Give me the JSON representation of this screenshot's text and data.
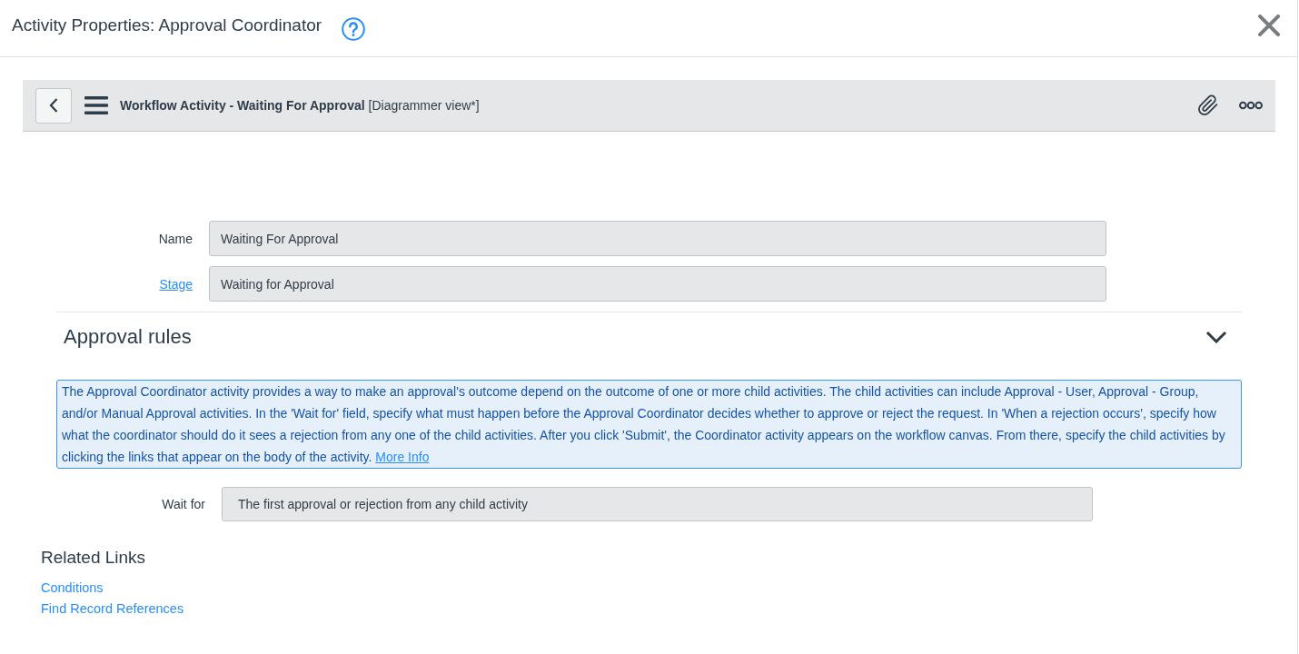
{
  "header": {
    "title": "Activity Properties: Approval Coordinator"
  },
  "form_header": {
    "title": "**Workflow Activity - Waiting For Approval** [Diagrammer view*]"
  },
  "fields": [
    {
      "label": "Name",
      "label_link": false,
      "value": "Waiting For Approval"
    },
    {
      "label": "Stage",
      "label_link": true,
      "value": "Waiting for Approval"
    }
  ],
  "section": {
    "title": "Approval rules",
    "expanded": true,
    "info": {
      "text": "The Approval Coordinator activity provides a way to make an approval's outcome depend on the outcome of one or more child activities. The child activities can include Approval - User, Approval - Group, and/or Manual Approval activities. In the 'Wait for' field, specify what must happen before the Approval Coordinator decides whether to approve or reject the request. In 'When a rejection occurs', specify how what the coordinator should do it sees a rejection from any one of the child activities. After you click 'Submit', the Coordinator activity appears on the workflow canvas. From there, specify the child activities by clicking the links that appear on the body of the activity.",
      "link": "More Info"
    },
    "fields": [
      {
        "label": "Wait for",
        "label_link": false,
        "value": "The first approval or rejection from any child activity"
      }
    ]
  },
  "related_links": {
    "title": "Related Links",
    "links": [
      "Conditions",
      "Find Record References"
    ]
  }
}
